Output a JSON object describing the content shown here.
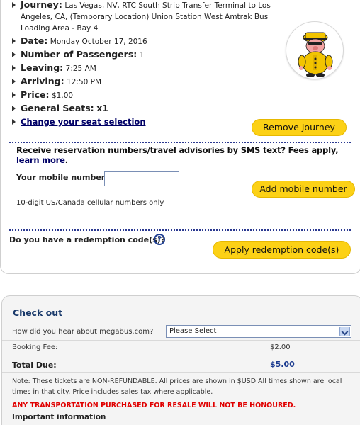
{
  "journey": {
    "journey_label": "Journey:",
    "journey_value": "Las Vegas, NV, RTC South Strip Transfer Terminal to Los Angeles, CA, (Temporary Location) Union Station West Amtrak Bus Loading Area - Bay 4",
    "date_label": "Date:",
    "date_value": "Monday October 17, 2016",
    "passengers_label": "Number of Passengers:",
    "passengers_value": "1",
    "leaving_label": "Leaving:",
    "leaving_value": "7:25 AM",
    "arriving_label": "Arriving:",
    "arriving_value": "12:50 PM",
    "price_label": "Price:",
    "price_value": "$1.00",
    "seats_label": "General Seats:",
    "seats_value": "x1",
    "change_seat_link": "Change your seat selection",
    "remove_button": "Remove Journey"
  },
  "sms": {
    "text": "Receive reservation numbers/travel advisories by SMS text? Fees apply,",
    "learn_more_link": "learn more",
    "period": ".",
    "mobile_label": "Your mobile number",
    "mobile_value": "",
    "add_button": "Add mobile number",
    "hint": "10-digit US/Canada cellular numbers only"
  },
  "redemption": {
    "question": "Do you have a redemption code(s)?",
    "help_icon": "?",
    "apply_button": "Apply redemption code(s)"
  },
  "checkout": {
    "title": "Check out",
    "hear_label": "How did you hear about megabus.com?",
    "hear_select_value": "Please Select",
    "booking_fee_label": "Booking Fee:",
    "booking_fee_value": "$2.00",
    "total_label": "Total Due:",
    "total_value": "$5.00",
    "note": "Note: These tickets are NON-REFUNDABLE. All prices are shown in $USD All times shown are local times in that city. Price includes sales tax where applicable.",
    "warning": "ANY TRANSPORTATION PURCHASED FOR RESALE WILL NOT BE HONOURED.",
    "important": "Important information"
  },
  "colors": {
    "button_yellow": "#fcd116",
    "link_navy": "#000066",
    "divider_blue": "#2b3990",
    "total_blue": "#1a3a8f",
    "warning_red": "#e00000"
  }
}
